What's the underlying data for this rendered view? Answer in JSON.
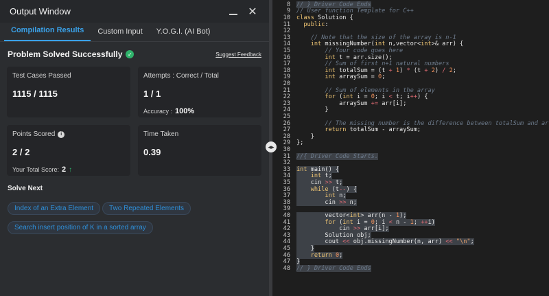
{
  "window": {
    "title": "Output Window"
  },
  "tabs": [
    {
      "label": "Compilation Results",
      "active": true
    },
    {
      "label": "Custom Input",
      "active": false
    },
    {
      "label": "Y.O.G.I. (AI Bot)",
      "active": false
    }
  ],
  "status": {
    "title": "Problem Solved Successfully",
    "feedback_link": "Suggest Feedback"
  },
  "cards": {
    "test_cases": {
      "label": "Test Cases Passed",
      "value": "1115 / 1115"
    },
    "attempts": {
      "label": "Attempts : Correct / Total",
      "value": "1 / 1",
      "accuracy_label": "Accuracy :",
      "accuracy_value": "100%"
    },
    "points": {
      "label": "Points Scored",
      "value": "2 / 2",
      "total_label": "Your Total Score:",
      "total_value": "2"
    },
    "time": {
      "label": "Time Taken",
      "value": "0.39"
    }
  },
  "solve_next": {
    "heading": "Solve Next",
    "items": [
      "Index of an Extra Element",
      "Two Repeated Elements",
      "Search insert position of K in a sorted array"
    ]
  },
  "colors": {
    "accent": "#3aa1e8",
    "success": "#2fb36b",
    "panel": "#2b2d30",
    "card": "#242528",
    "editor_bg": "#1e1e1e"
  },
  "icons": [
    "minimize-icon",
    "close-icon",
    "check-circle-icon",
    "info-icon",
    "arrow-up-icon",
    "drag-handle-icon"
  ],
  "editor": {
    "lines": [
      {
        "n": "8",
        "html": "<span class=\"cm\">// } Driver Code Ends</span>",
        "hl": true
      },
      {
        "n": "9",
        "html": "<span class=\"cm\">// User function Template for C++</span>"
      },
      {
        "n": "10",
        "html": "<span class=\"kw\">class</span> Solution {"
      },
      {
        "n": "11",
        "html": "  <span class=\"kw\">public</span>:"
      },
      {
        "n": "12",
        "html": ""
      },
      {
        "n": "13",
        "html": "    <span class=\"cm\">// Note that the size of the array is n-1</span>"
      },
      {
        "n": "14",
        "html": "    <span class=\"kw\">int</span> missingNumber(<span class=\"kw\">int</span> n,vector&lt;<span class=\"kw\">int</span>&gt;&amp; arr) {"
      },
      {
        "n": "15",
        "html": "        <span class=\"cm\">// Your code goes here</span>"
      },
      {
        "n": "16",
        "html": "        <span class=\"kw\">int</span> t = arr.size();"
      },
      {
        "n": "17",
        "html": "        <span class=\"cm\">// Sum of first n+1 natural numbers</span>"
      },
      {
        "n": "18",
        "html": "        <span class=\"kw\">int</span> totalSum = (t <span class=\"op\">+</span> <span class=\"num\">1</span>) <span class=\"op\">*</span> (t <span class=\"op\">+</span> <span class=\"num\">2</span>) <span class=\"op\">/</span> <span class=\"num\">2</span>;"
      },
      {
        "n": "19",
        "html": "        <span class=\"kw\">int</span> arraySum = <span class=\"num\">0</span>;"
      },
      {
        "n": "20",
        "html": ""
      },
      {
        "n": "21",
        "html": "        <span class=\"cm\">// Sum of elements in the array</span>"
      },
      {
        "n": "22",
        "html": "        <span class=\"kw\">for</span> (<span class=\"kw\">int</span> i = <span class=\"num\">0</span>; i <span class=\"op\">&lt;</span> t; i<span class=\"op\">++</span>) {"
      },
      {
        "n": "23",
        "html": "            arraySum <span class=\"op\">+=</span> arr[i];"
      },
      {
        "n": "24",
        "html": "        }"
      },
      {
        "n": "25",
        "html": ""
      },
      {
        "n": "26",
        "html": "        <span class=\"cm\">// The missing number is the difference between totalSum and arraySum</span>"
      },
      {
        "n": "27",
        "html": "        <span class=\"kw\">return</span> totalSum - arraySum;"
      },
      {
        "n": "28",
        "html": "    }"
      },
      {
        "n": "29",
        "html": "};"
      },
      {
        "n": "30",
        "html": ""
      },
      {
        "n": "31",
        "html": "<span class=\"cm\">//{ Driver Code Starts.</span>",
        "hl": true
      },
      {
        "n": "32",
        "html": "",
        "hl": true
      },
      {
        "n": "33",
        "html": "<span class=\"kw\">int</span> main() {",
        "hl": true
      },
      {
        "n": "34",
        "html": "    <span class=\"kw\">int</span> t;",
        "hl": true
      },
      {
        "n": "35",
        "html": "    cin <span class=\"op\">&gt;&gt;</span> t;",
        "hl": true
      },
      {
        "n": "36",
        "html": "    <span class=\"kw\">while</span> (t<span class=\"op\">--</span>) {",
        "hl": true
      },
      {
        "n": "37",
        "html": "        <span class=\"kw\">int</span> n;",
        "hl": true
      },
      {
        "n": "38",
        "html": "        cin <span class=\"op\">&gt;&gt;</span> n;",
        "hl": true
      },
      {
        "n": "39",
        "html": "",
        "hl": true
      },
      {
        "n": "40",
        "html": "        vector&lt;<span class=\"kw\">int</span>&gt; arr(n - <span class=\"num\">1</span>);",
        "hl": true
      },
      {
        "n": "41",
        "html": "        <span class=\"kw\">for</span> (<span class=\"kw\">int</span> i = <span class=\"num\">0</span>; i <span class=\"op\">&lt;</span> n - <span class=\"num\">1</span>; <span class=\"op\">++</span>i)",
        "hl": true
      },
      {
        "n": "42",
        "html": "            cin <span class=\"op\">&gt;&gt;</span> arr[i];",
        "hl": true
      },
      {
        "n": "43",
        "html": "        Solution obj;",
        "hl": true
      },
      {
        "n": "44",
        "html": "        cout <span class=\"op\">&lt;&lt;</span> obj.missingNumber(n, arr) <span class=\"op\">&lt;&lt;</span> <span class=\"str\">\"\\n\"</span>;",
        "hl": true
      },
      {
        "n": "45",
        "html": "    }",
        "hl": true
      },
      {
        "n": "46",
        "html": "    <span class=\"kw\">return</span> <span class=\"num\">0</span>;",
        "hl": true
      },
      {
        "n": "47",
        "html": "}",
        "hl": true
      },
      {
        "n": "48",
        "html": "<span class=\"cm\">// } Driver Code Ends</span>",
        "hl": true
      }
    ]
  }
}
